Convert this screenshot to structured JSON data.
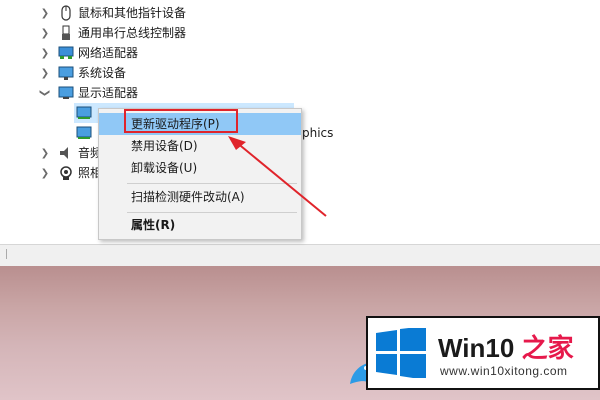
{
  "device_tree": {
    "items": [
      {
        "label": "鼠标和其他指针设备",
        "icon": "mouse-icon",
        "expanded": false
      },
      {
        "label": "通用串行总线控制器",
        "icon": "usb-icon",
        "expanded": false
      },
      {
        "label": "网络适配器",
        "icon": "network-adapter-icon",
        "expanded": false
      },
      {
        "label": "系统设备",
        "icon": "system-device-icon",
        "expanded": false
      },
      {
        "label": "显示适配器",
        "icon": "display-adapter-icon",
        "expanded": true
      },
      {
        "label": "音频",
        "icon": "audio-icon",
        "expanded": false
      },
      {
        "label": "照相",
        "icon": "camera-icon",
        "expanded": false
      }
    ],
    "child_fragment": "phics"
  },
  "context_menu": {
    "items": [
      {
        "label": "更新驱动程序(P)",
        "highlighted": true
      },
      {
        "label": "禁用设备(D)"
      },
      {
        "label": "卸载设备(U)"
      },
      {
        "label": "扫描检测硬件改动(A)"
      },
      {
        "label": "属性(R)",
        "bold": true
      }
    ]
  },
  "watermark": {
    "title_prefix": "Win10",
    "title_suffix": " 之家",
    "url": "www.win10xitong.com"
  },
  "colors": {
    "accent": "#e0242b",
    "menu_highlight": "#90c8f6",
    "win_blue": "#0a7bd4"
  }
}
